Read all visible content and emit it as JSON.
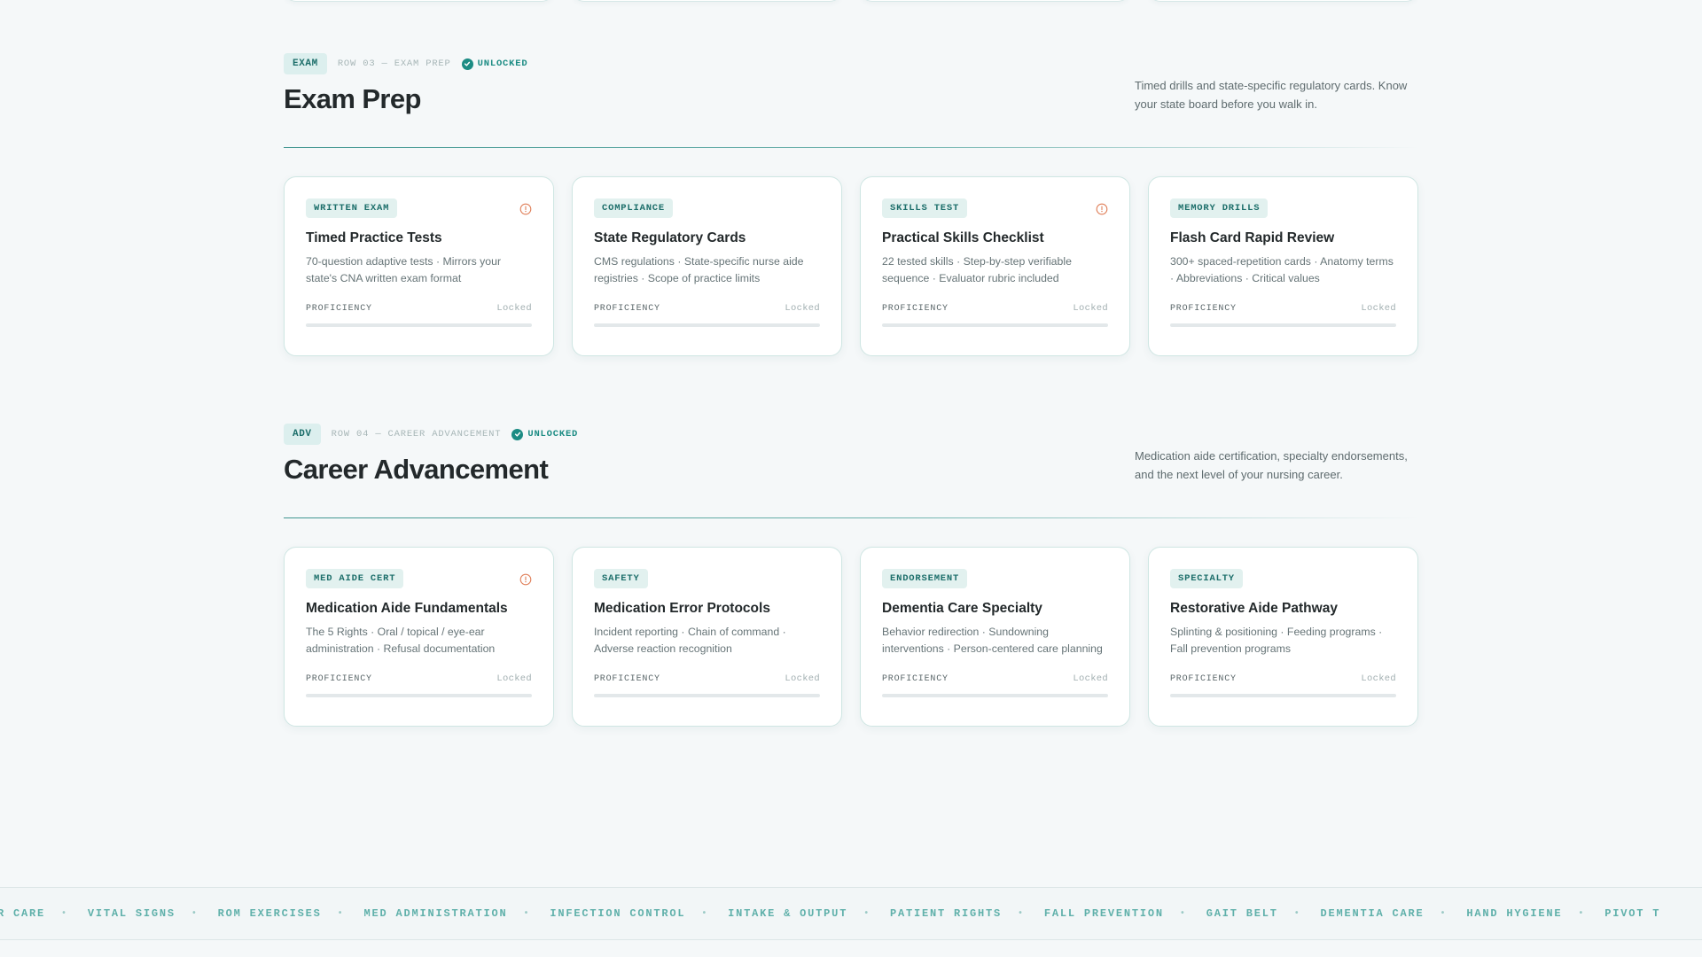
{
  "sections": [
    {
      "tag": "EXAM",
      "row_label": "ROW 03 — EXAM PREP",
      "status": "UNLOCKED",
      "title": "Exam Prep",
      "description": "Timed drills and state-specific regulatory cards. Know your state board before you walk in.",
      "cards": [
        {
          "tag": "WRITTEN EXAM",
          "title": "Timed Practice Tests",
          "desc": "70-question adaptive tests · Mirrors your state's CNA written exam format",
          "alert": true,
          "proficiency_label": "PROFICIENCY",
          "status": "Locked",
          "progress": 0
        },
        {
          "tag": "COMPLIANCE",
          "title": "State Regulatory Cards",
          "desc": "CMS regulations · State-specific nurse aide registries · Scope of practice limits",
          "alert": false,
          "proficiency_label": "PROFICIENCY",
          "status": "Locked",
          "progress": 0
        },
        {
          "tag": "SKILLS TEST",
          "title": "Practical Skills Checklist",
          "desc": "22 tested skills · Step-by-step verifiable sequence · Evaluator rubric included",
          "alert": true,
          "proficiency_label": "PROFICIENCY",
          "status": "Locked",
          "progress": 0
        },
        {
          "tag": "MEMORY DRILLS",
          "title": "Flash Card Rapid Review",
          "desc": "300+ spaced-repetition cards · Anatomy terms · Abbreviations · Critical values",
          "alert": false,
          "proficiency_label": "PROFICIENCY",
          "status": "Locked",
          "progress": 0
        }
      ]
    },
    {
      "tag": "ADV",
      "row_label": "ROW 04 — CAREER ADVANCEMENT",
      "status": "UNLOCKED",
      "title": "Career Advancement",
      "description": "Medication aide certification, specialty endorsements, and the next level of your nursing career.",
      "cards": [
        {
          "tag": "MED AIDE CERT",
          "title": "Medication Aide Fundamentals",
          "desc": "The 5 Rights · Oral / topical / eye-ear administration · Refusal documentation",
          "alert": true,
          "proficiency_label": "PROFICIENCY",
          "status": "Locked",
          "progress": 0
        },
        {
          "tag": "SAFETY",
          "title": "Medication Error Protocols",
          "desc": "Incident reporting · Chain of command · Adverse reaction recognition",
          "alert": false,
          "proficiency_label": "PROFICIENCY",
          "status": "Locked",
          "progress": 0
        },
        {
          "tag": "ENDORSEMENT",
          "title": "Dementia Care Specialty",
          "desc": "Behavior redirection · Sundowning interventions · Person-centered care planning",
          "alert": false,
          "proficiency_label": "PROFICIENCY",
          "status": "Locked",
          "progress": 0
        },
        {
          "tag": "SPECIALTY",
          "title": "Restorative Aide Pathway",
          "desc": "Splinting & positioning · Feeding programs · Fall prevention programs",
          "alert": false,
          "proficiency_label": "PROFICIENCY",
          "status": "Locked",
          "progress": 0
        }
      ]
    }
  ],
  "ticker": {
    "separator": "•",
    "items": [
      "ETER CARE",
      "VITAL SIGNS",
      "ROM EXERCISES",
      "MED ADMINISTRATION",
      "INFECTION CONTROL",
      "INTAKE & OUTPUT",
      "PATIENT RIGHTS",
      "FALL PREVENTION",
      "GAIT BELT",
      "DEMENTIA CARE",
      "HAND HYGIENE",
      "PIVOT T"
    ]
  },
  "colors": {
    "accent": "#1c8c84",
    "alert": "#e0805a",
    "background": "#f5f8f9"
  },
  "icons": {
    "status": "check-circle-icon",
    "card_alert": "alert-circle-icon"
  }
}
